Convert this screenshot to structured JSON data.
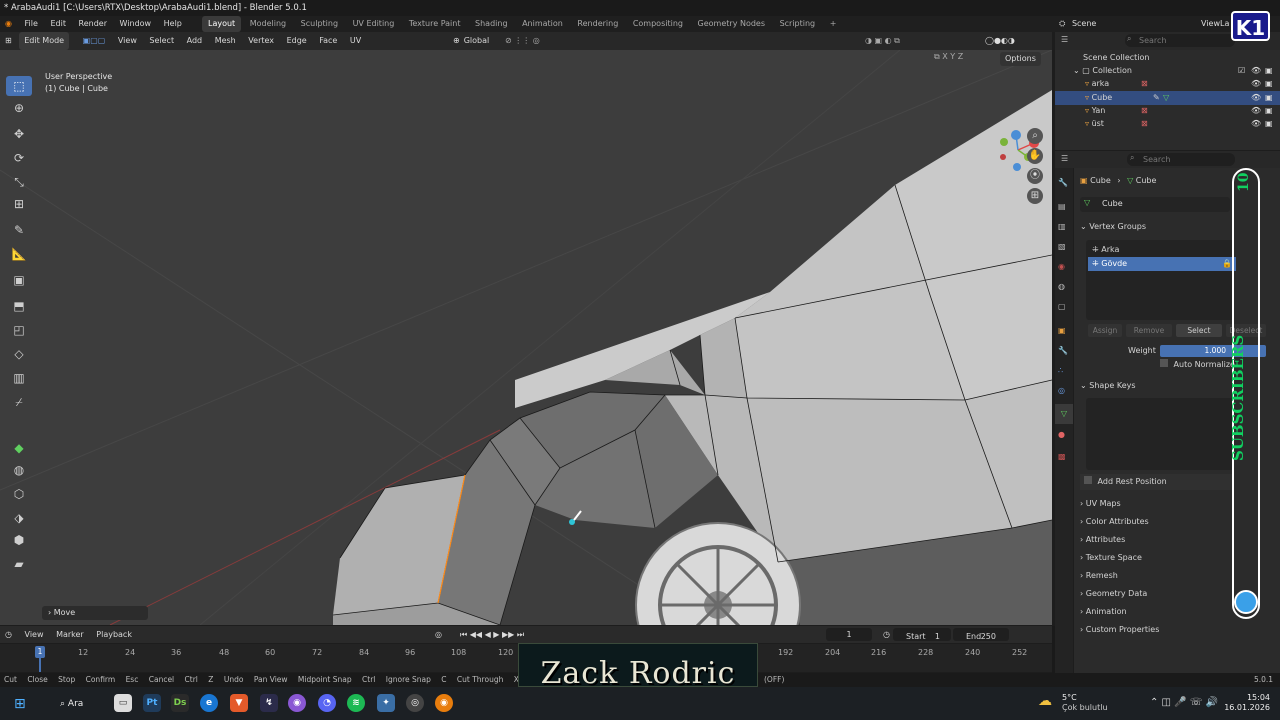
{
  "window": {
    "title": "* ArabaAudi1 [C:\\Users\\RTX\\Desktop\\ArabaAudi1.blend] - Blender 5.0.1"
  },
  "menu": {
    "items": [
      "File",
      "Edit",
      "Render",
      "Window",
      "Help"
    ],
    "workspaces": [
      "Layout",
      "Modeling",
      "Sculpting",
      "UV Editing",
      "Texture Paint",
      "Shading",
      "Animation",
      "Rendering",
      "Compositing",
      "Geometry Nodes",
      "Scripting"
    ],
    "add_tab": "+",
    "scene_label": "Scene",
    "viewlayer_label": "ViewLa"
  },
  "viewport_header": {
    "mode": "Edit Mode",
    "menus": [
      "View",
      "Select",
      "Add",
      "Mesh",
      "Vertex",
      "Edge",
      "Face",
      "UV"
    ],
    "transform_orientation": "Global",
    "options": "Options",
    "axes": [
      "X",
      "Y",
      "Z"
    ]
  },
  "viewport": {
    "perspective": "User Perspective",
    "object": "(1) Cube | Cube",
    "operator_panel": "Move",
    "gizmo_axes": [
      "X",
      "Y",
      "Z"
    ]
  },
  "outliner": {
    "search_placeholder": "Search",
    "scene_collection": "Scene Collection",
    "collection": "Collection",
    "objects": [
      "arka",
      "Cube",
      "Yan",
      "üst"
    ]
  },
  "properties": {
    "search_placeholder": "Search",
    "breadcrumb": [
      "Cube",
      "Cube"
    ],
    "mesh_name": "Cube",
    "vertex_groups_title": "Vertex Groups",
    "vertex_groups": [
      "Arka",
      "Gövde"
    ],
    "buttons": [
      "Assign",
      "Remove",
      "Select",
      "Deselect"
    ],
    "weight_label": "Weight",
    "weight_value": "1.000",
    "auto_normalize": "Auto Normalize",
    "shape_keys_title": "Shape Keys",
    "add_rest_position": "Add Rest Position",
    "panels": [
      "UV Maps",
      "Color Attributes",
      "Attributes",
      "Texture Space",
      "Remesh",
      "Geometry Data",
      "Animation",
      "Custom Properties"
    ]
  },
  "timeline": {
    "menus": [
      "View",
      "Marker",
      "Playback"
    ],
    "current_frame": "1",
    "start_label": "Start",
    "start_value": "1",
    "end_label": "End",
    "end_value": "250",
    "ruler_ticks": [
      "1",
      "12",
      "24",
      "36",
      "48",
      "60",
      "72",
      "84",
      "96",
      "108",
      "120",
      "192",
      "204",
      "216",
      "228",
      "240",
      "252"
    ]
  },
  "statusbar": {
    "hints": [
      "Cut",
      "Close",
      "Stop",
      "Confirm",
      "Esc",
      "Cancel",
      "Ctrl",
      "Z",
      "Undo",
      "Pan View",
      "Midpoint Snap",
      "Ctrl",
      "Ignore Snap",
      "C",
      "Cut Through",
      "X"
    ],
    "extra": "(OFF)",
    "version": "5.0.1"
  },
  "overlay": {
    "channel_logo": "K1",
    "subscribe_text": "SUBSCRIBERS",
    "subscribe_count": "10",
    "banner": "Zack Rodric"
  },
  "taskbar": {
    "search": "Ara",
    "weather_temp": "5°C",
    "weather_desc": "Çok bulutlu",
    "time": "15:04",
    "date": "16.01.2026"
  }
}
